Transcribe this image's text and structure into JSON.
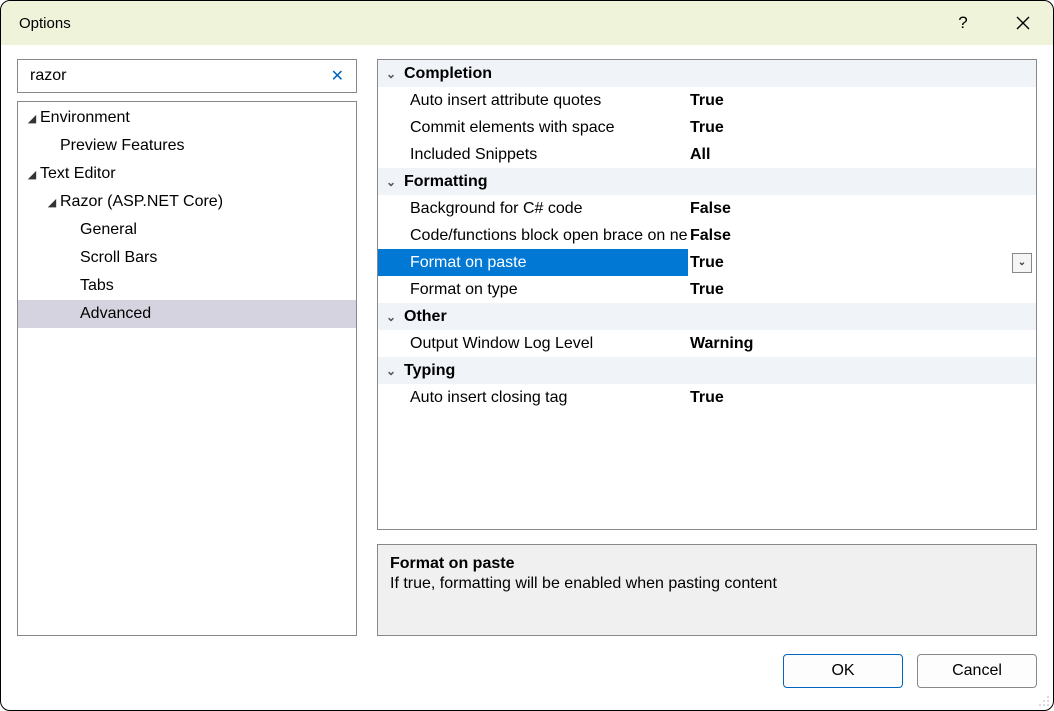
{
  "window": {
    "title": "Options"
  },
  "search": {
    "value": "razor"
  },
  "tree": [
    {
      "label": "Environment",
      "level": 0,
      "expanded": true,
      "hasChildren": true,
      "selected": false
    },
    {
      "label": "Preview Features",
      "level": 1,
      "expanded": false,
      "hasChildren": false,
      "selected": false
    },
    {
      "label": "Text Editor",
      "level": 0,
      "expanded": true,
      "hasChildren": true,
      "selected": false
    },
    {
      "label": "Razor (ASP.NET Core)",
      "level": 1,
      "expanded": true,
      "hasChildren": true,
      "selected": false
    },
    {
      "label": "General",
      "level": 2,
      "expanded": false,
      "hasChildren": false,
      "selected": false
    },
    {
      "label": "Scroll Bars",
      "level": 2,
      "expanded": false,
      "hasChildren": false,
      "selected": false
    },
    {
      "label": "Tabs",
      "level": 2,
      "expanded": false,
      "hasChildren": false,
      "selected": false
    },
    {
      "label": "Advanced",
      "level": 2,
      "expanded": false,
      "hasChildren": false,
      "selected": true
    }
  ],
  "propgrid": [
    {
      "type": "category",
      "label": "Completion"
    },
    {
      "type": "prop",
      "name": "Auto insert attribute quotes",
      "value": "True",
      "selected": false
    },
    {
      "type": "prop",
      "name": "Commit elements with space",
      "value": "True",
      "selected": false
    },
    {
      "type": "prop",
      "name": "Included Snippets",
      "value": "All",
      "selected": false
    },
    {
      "type": "category",
      "label": "Formatting"
    },
    {
      "type": "prop",
      "name": "Background for C# code",
      "value": "False",
      "selected": false
    },
    {
      "type": "prop",
      "name": "Code/functions block open brace on next line",
      "value": "False",
      "selected": false
    },
    {
      "type": "prop",
      "name": "Format on paste",
      "value": "True",
      "selected": true
    },
    {
      "type": "prop",
      "name": "Format on type",
      "value": "True",
      "selected": false
    },
    {
      "type": "category",
      "label": "Other"
    },
    {
      "type": "prop",
      "name": "Output Window Log Level",
      "value": "Warning",
      "selected": false
    },
    {
      "type": "category",
      "label": "Typing"
    },
    {
      "type": "prop",
      "name": "Auto insert closing tag",
      "value": "True",
      "selected": false
    }
  ],
  "description": {
    "title": "Format on paste",
    "text": "If true, formatting will be enabled when pasting content"
  },
  "buttons": {
    "ok": "OK",
    "cancel": "Cancel"
  }
}
